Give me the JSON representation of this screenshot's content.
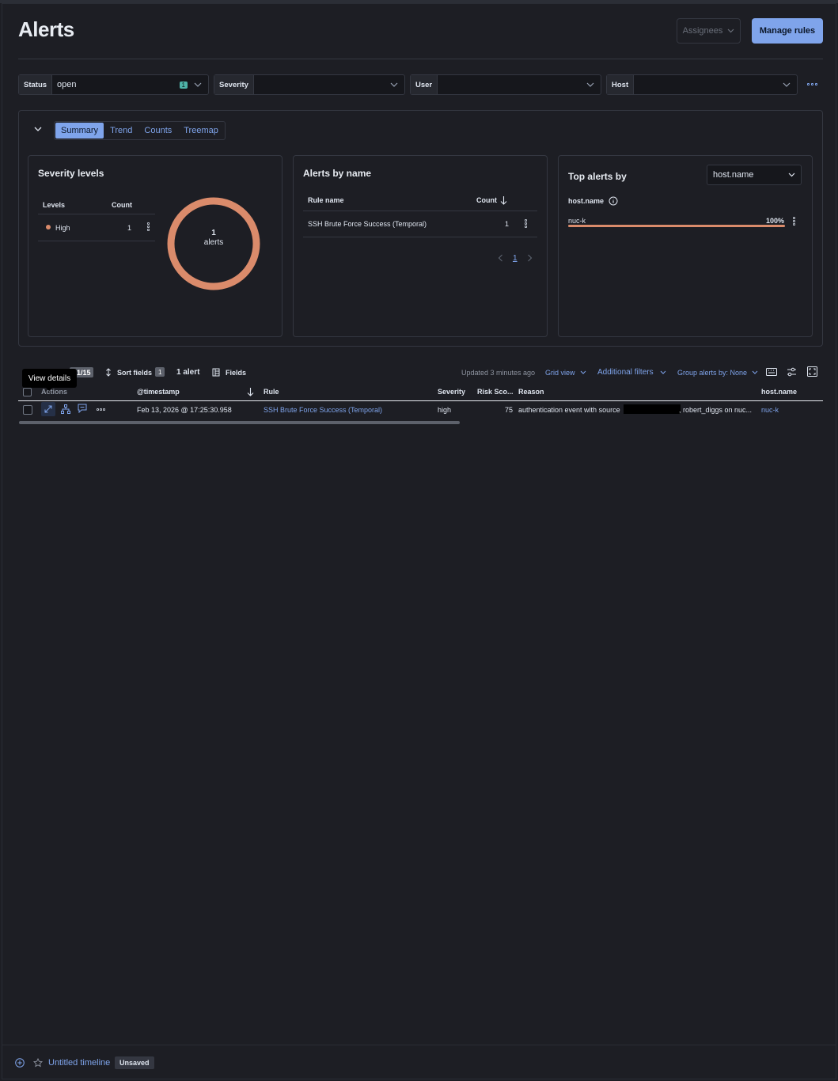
{
  "page": {
    "title": "Alerts"
  },
  "header": {
    "assignees_label": "Assignees",
    "manage_rules_label": "Manage rules"
  },
  "filters": [
    {
      "label": "Status",
      "value": "open",
      "count": "1"
    },
    {
      "label": "Severity",
      "value": ""
    },
    {
      "label": "User",
      "value": ""
    },
    {
      "label": "Host",
      "value": ""
    }
  ],
  "tabs": [
    "Summary",
    "Trend",
    "Counts",
    "Treemap"
  ],
  "severity_card": {
    "title": "Severity levels",
    "col_levels": "Levels",
    "col_count": "Count",
    "row_level": "High",
    "row_count": "1",
    "donut_count": "1",
    "donut_label": "alerts",
    "color_high": "#da8b6b"
  },
  "alerts_by_name": {
    "title": "Alerts by name",
    "col_rule": "Rule name",
    "col_count": "Count",
    "row_rule": "SSH Brute Force Success (Temporal)",
    "row_count": "1",
    "page": "1"
  },
  "top_alerts": {
    "title": "Top alerts by",
    "select_value": "host.name",
    "field_label": "host.name",
    "row_name": "nuc-k",
    "row_pct": "100%",
    "fraction": 1.0
  },
  "toolbar": {
    "counter": "1/15",
    "sort_fields": "Sort fields",
    "sort_count": "1",
    "alert_count": "1 alert",
    "fields": "Fields",
    "updated": "Updated 3 minutes ago",
    "grid_view": "Grid view",
    "additional_filters": "Additional filters",
    "group_by": "Group alerts by: None"
  },
  "tooltip": "View details",
  "table": {
    "columns": [
      "Actions",
      "@timestamp",
      "Rule",
      "Severity",
      "Risk Sco...",
      "Reason",
      "host.name"
    ],
    "row": {
      "timestamp": "Feb 13, 2026 @ 17:25:30.958",
      "rule": "SSH Brute Force Success (Temporal)",
      "severity": "high",
      "risk": "75",
      "reason_start": "authentication event with source",
      "reason_end": ", robert_diggs on nuc...",
      "host": "nuc-k"
    }
  },
  "timeline": {
    "title": "Untitled timeline",
    "status": "Unsaved"
  }
}
